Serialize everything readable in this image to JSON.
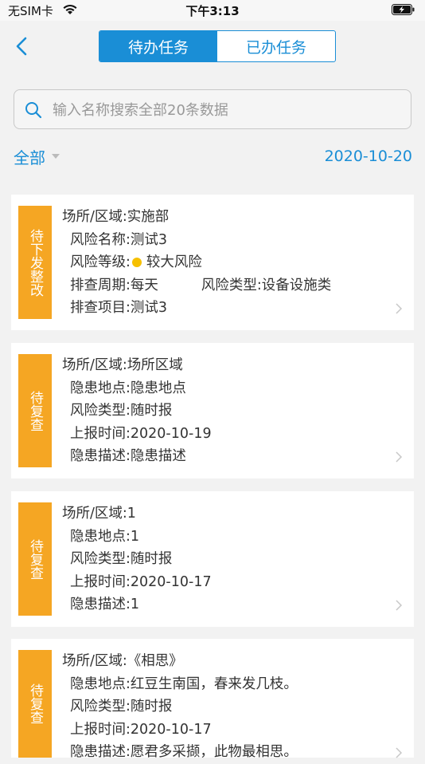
{
  "status_bar": {
    "carrier": "无SIM卡",
    "time": "下午3:13"
  },
  "nav": {
    "tabs": [
      {
        "label": "待办任务",
        "active": true
      },
      {
        "label": "已办任务",
        "active": false
      }
    ]
  },
  "search": {
    "placeholder": "输入名称搜索全部20条数据",
    "value": ""
  },
  "filter": {
    "selected": "全部",
    "date": "2020-10-20"
  },
  "colors": {
    "accent": "#1a8ed6",
    "tag": "#f5a623",
    "risk_dot": "#f6c000"
  },
  "cards": [
    {
      "tag": "待下发整改",
      "area": "场所/区域:实施部",
      "risk_name": "风险名称:测试3",
      "risk_level_label": "风险等级:",
      "risk_level_value": "较大风险",
      "check_cycle": "排查周期:每天",
      "risk_type": "风险类型:设备设施类",
      "check_item": "排查项目:测试3"
    },
    {
      "tag": "待复查",
      "area": "场所/区域:场所区域",
      "location": "隐患地点:隐患地点",
      "risk_type": "风险类型:随时报",
      "report_time": "上报时间:2020-10-19",
      "description": "隐患描述:隐患描述"
    },
    {
      "tag": "待复查",
      "area": "场所/区域:1",
      "location": "隐患地点:1",
      "risk_type": "风险类型:随时报",
      "report_time": "上报时间:2020-10-17",
      "description": "隐患描述:1"
    },
    {
      "tag": "待复查",
      "area": "场所/区域:《相思》",
      "location": "隐患地点:红豆生南国，春来发几枝。",
      "risk_type": "风险类型:随时报",
      "report_time": "上报时间:2020-10-17",
      "description": "隐患描述:愿君多采撷，此物最相思。"
    }
  ]
}
